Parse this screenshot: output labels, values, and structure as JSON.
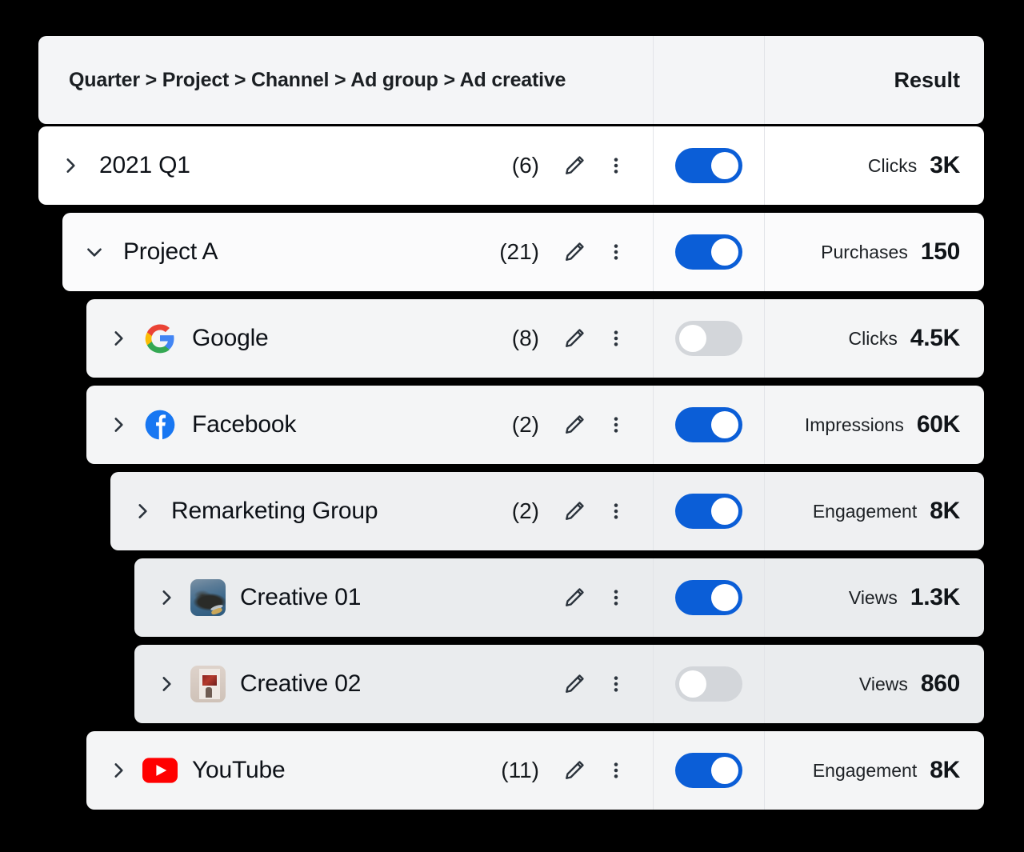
{
  "header": {
    "breadcrumb": "Quarter > Project > Channel > Ad group > Ad creative",
    "result_label": "Result"
  },
  "icons": {
    "chevron_right": "chevron-right-icon",
    "chevron_down": "chevron-down-icon",
    "edit": "pencil-icon",
    "menu": "more-vertical-icon"
  },
  "colors": {
    "toggle_on": "#0b5ed7",
    "toggle_off": "#d3d6da",
    "google_red": "#ea4335",
    "google_yellow": "#fbbc05",
    "google_green": "#34a853",
    "google_blue": "#4285f4",
    "facebook_blue": "#1877f2",
    "youtube_red": "#ff0000"
  },
  "rows": [
    {
      "name": "2021 Q1",
      "count": "(6)",
      "expanded": false,
      "toggle_on": true,
      "metric": "Clicks",
      "value": "3K",
      "depth": 0,
      "lead_icon": "none"
    },
    {
      "name": "Project A",
      "count": "(21)",
      "expanded": true,
      "toggle_on": true,
      "metric": "Purchases",
      "value": "150",
      "depth": 1,
      "lead_icon": "none"
    },
    {
      "name": "Google",
      "count": "(8)",
      "expanded": false,
      "toggle_on": false,
      "metric": "Clicks",
      "value": "4.5K",
      "depth": 2,
      "lead_icon": "google-logo-icon"
    },
    {
      "name": "Facebook",
      "count": "(2)",
      "expanded": false,
      "toggle_on": true,
      "metric": "Impressions",
      "value": "60K",
      "depth": 2,
      "lead_icon": "facebook-logo-icon"
    },
    {
      "name": "Remarketing Group",
      "count": "(2)",
      "expanded": false,
      "toggle_on": true,
      "metric": "Engagement",
      "value": "8K",
      "depth": 3,
      "lead_icon": "none"
    },
    {
      "name": "Creative 01",
      "count": "",
      "expanded": false,
      "toggle_on": true,
      "metric": "Views",
      "value": "1.3K",
      "depth": 4,
      "lead_icon": "thumbnail-coast-image"
    },
    {
      "name": "Creative 02",
      "count": "",
      "expanded": false,
      "toggle_on": false,
      "metric": "Views",
      "value": "860",
      "depth": 4,
      "lead_icon": "thumbnail-gallery-image"
    },
    {
      "name": "YouTube",
      "count": "(11)",
      "expanded": false,
      "toggle_on": true,
      "metric": "Engagement",
      "value": "8K",
      "depth": 2,
      "lead_icon": "youtube-logo-icon"
    }
  ]
}
